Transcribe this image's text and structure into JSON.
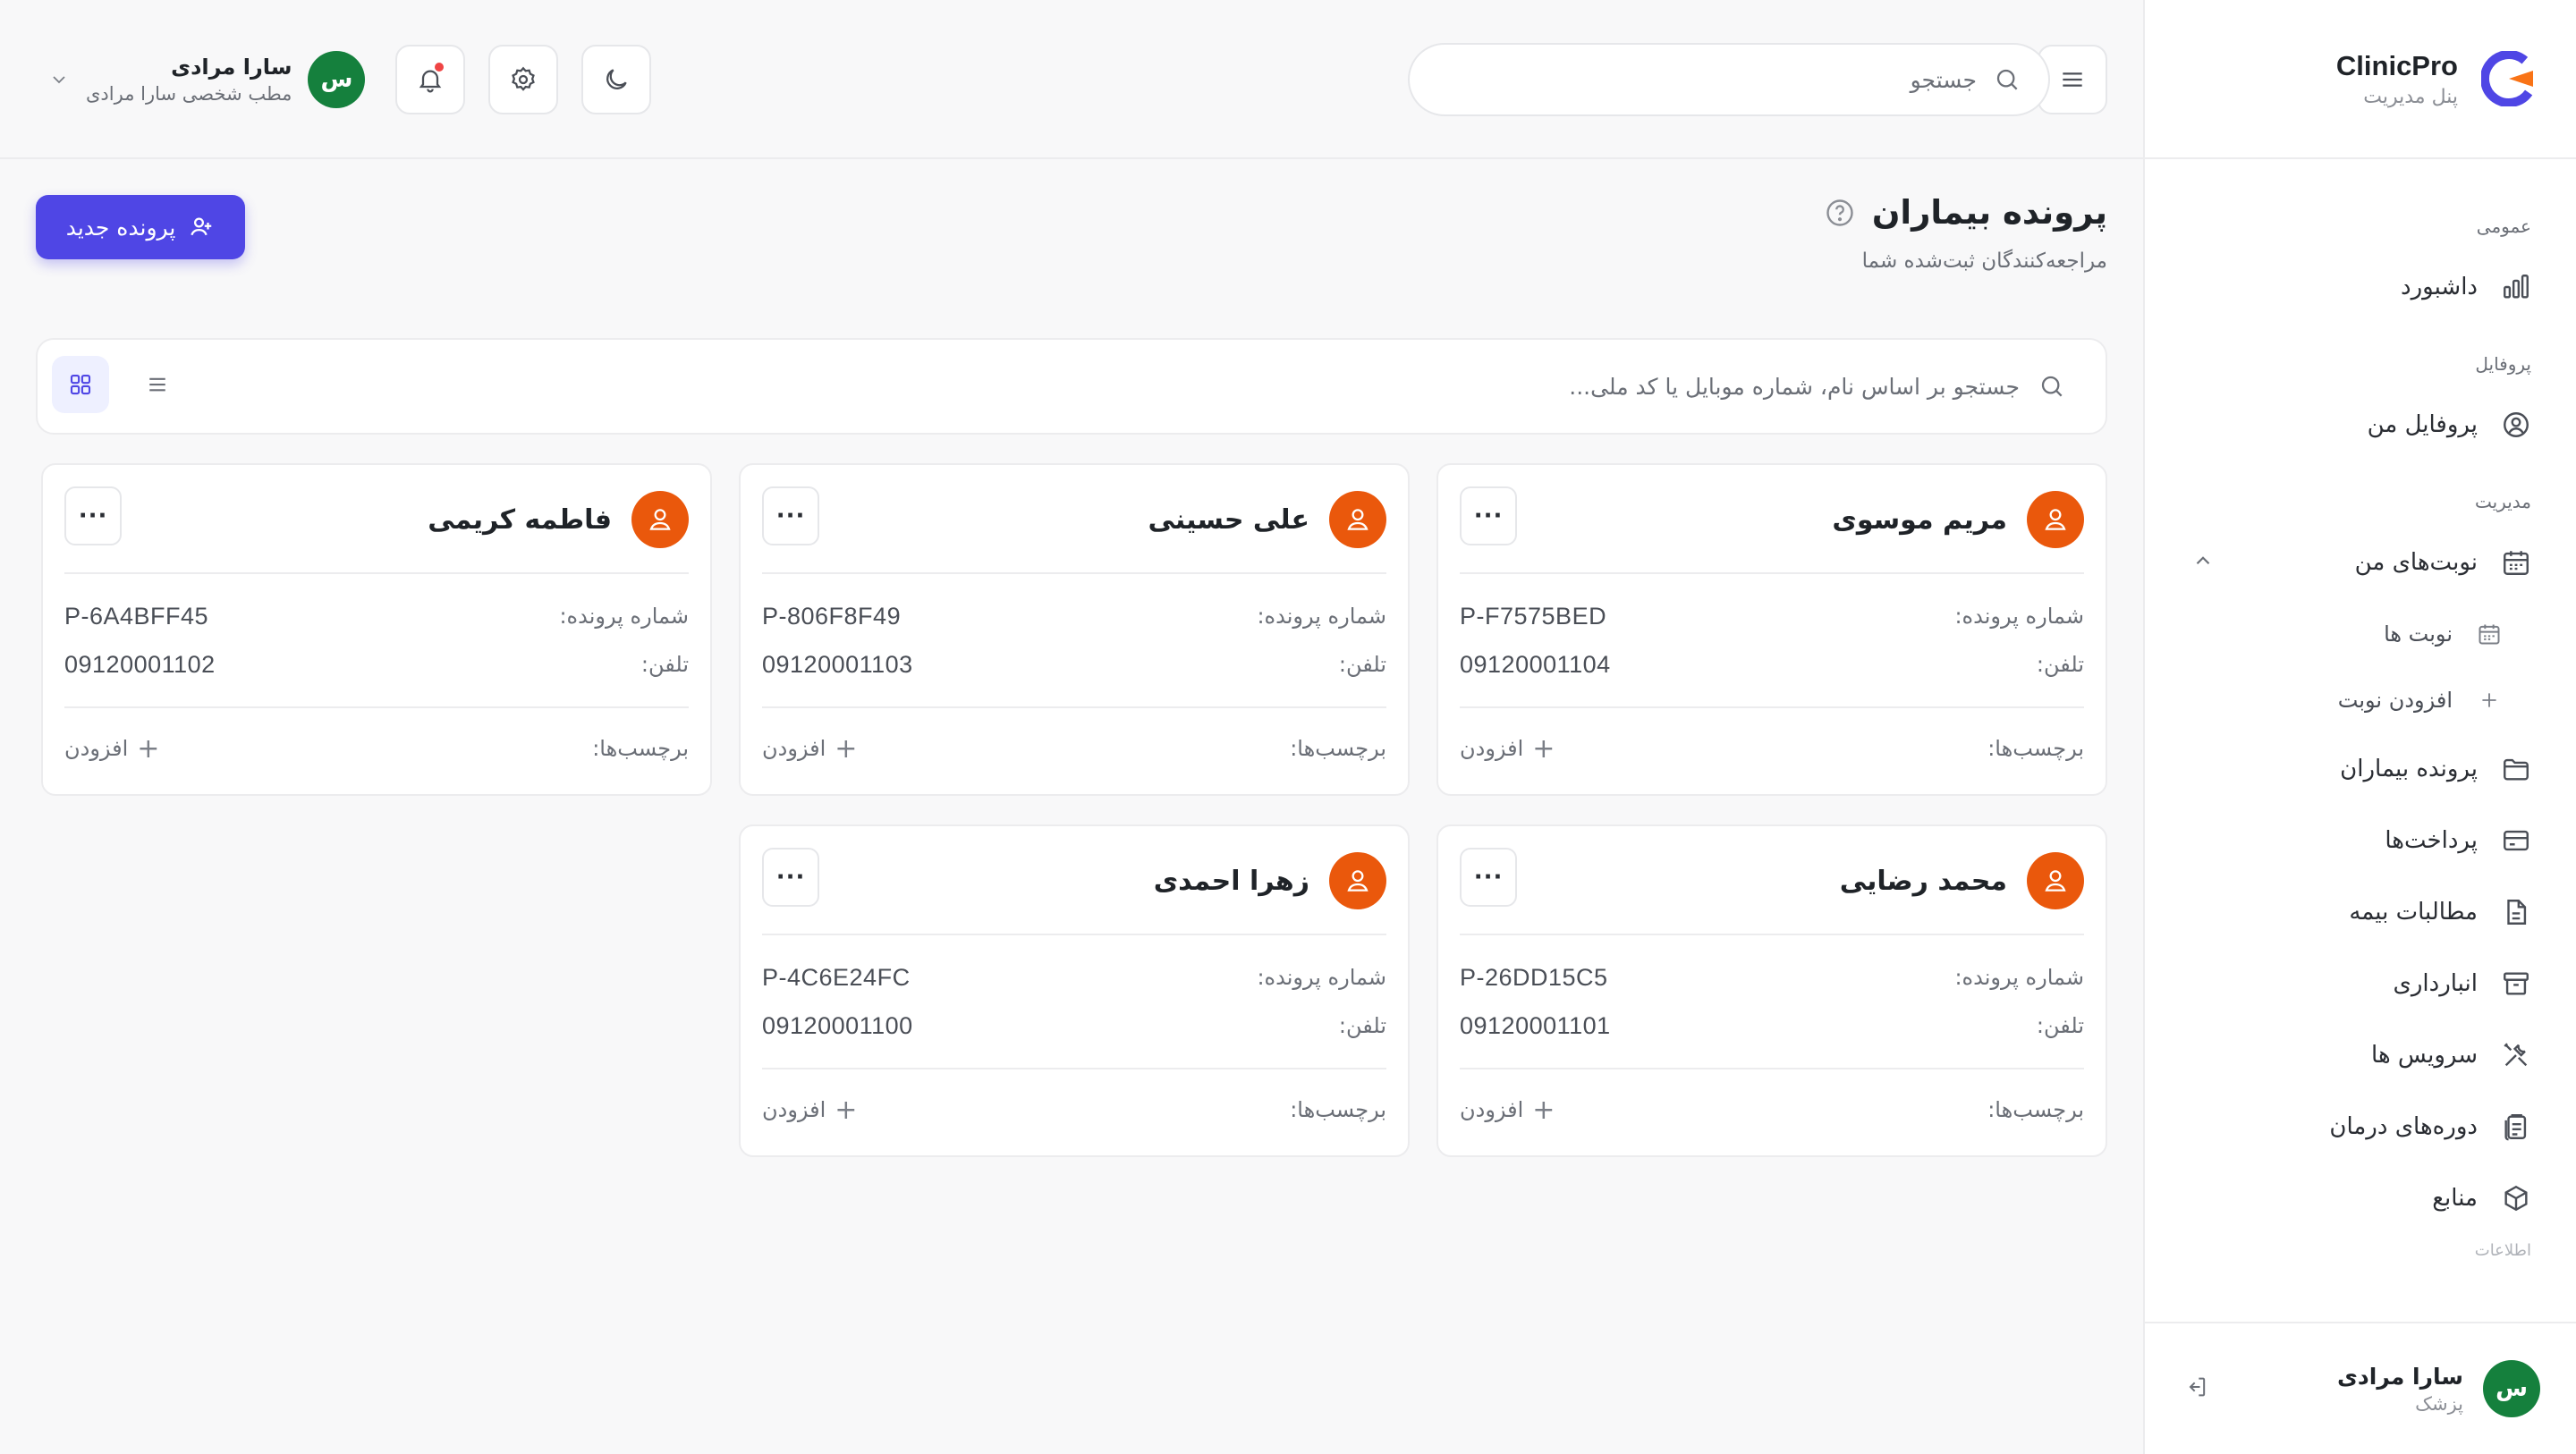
{
  "brand": {
    "name": "ClinicPro",
    "subtitle": "پنل مدیریت"
  },
  "sidebar": {
    "sections": [
      {
        "title": "عمومی"
      },
      {
        "title": "پروفایل"
      },
      {
        "title": "مدیریت"
      },
      {
        "title": "اطلاعات"
      }
    ],
    "items": {
      "dashboard": "داشبورد",
      "profile": "پروفایل من",
      "appointments": "نوبت‌های من",
      "appointments_list": "نوبت ها",
      "add_appointment": "افزودن نوبت",
      "patients": "پرونده بیماران",
      "payments": "پرداخت‌ها",
      "insurance": "مطالبات بیمه",
      "inventory": "انبارداری",
      "services": "سرویس ها",
      "treatments": "دوره‌های درمان",
      "resources": "منابع"
    },
    "user": {
      "initial": "س",
      "name": "سارا مرادی",
      "role": "پزشک"
    }
  },
  "topbar": {
    "search_placeholder": "جستجو",
    "user": {
      "initial": "س",
      "name": "سارا مرادی",
      "subtitle": "مطب شخصی سارا مرادی"
    }
  },
  "page": {
    "title": "پرونده بیماران",
    "subtitle": "مراجعه‌کنندگان ثبت‌شده شما",
    "new_button": "پرونده جدید",
    "filter_placeholder": "جستجو بر اساس نام، شماره موبایل یا کد ملی..."
  },
  "labels": {
    "file_no": "شماره پرونده:",
    "phone": "تلفن:",
    "tags": "برچسب‌ها:",
    "add": "افزودن",
    "more": "···"
  },
  "patients": [
    {
      "name": "مریم موسوی",
      "file_no": "P-F7575BED",
      "phone": "09120001104"
    },
    {
      "name": "علی حسینی",
      "file_no": "P-806F8F49",
      "phone": "09120001103"
    },
    {
      "name": "فاطمه کریمی",
      "file_no": "P-6A4BFF45",
      "phone": "09120001102"
    },
    {
      "name": "محمد رضایی",
      "file_no": "P-26DD15C5",
      "phone": "09120001101"
    },
    {
      "name": "زهرا احمدی",
      "file_no": "P-4C6E24FC",
      "phone": "09120001100"
    }
  ],
  "colors": {
    "accent": "#4f46e5",
    "avatar_green": "#15803d",
    "avatar_orange": "#ea580c",
    "notification": "#ef4444"
  }
}
